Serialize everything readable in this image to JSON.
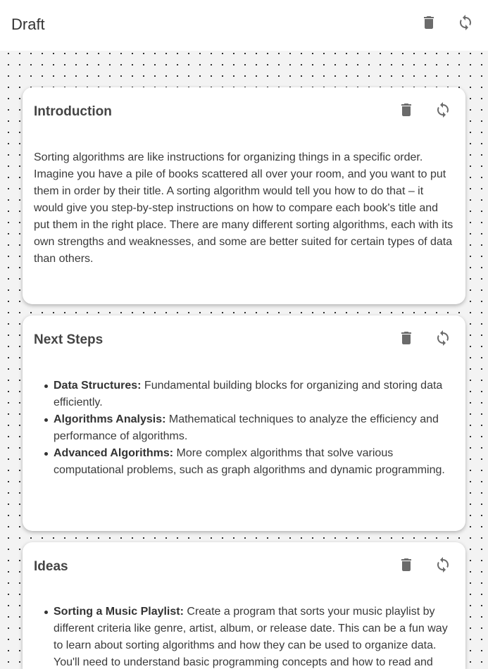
{
  "header": {
    "title": "Draft",
    "delete_icon": "trash-icon",
    "refresh_icon": "refresh-icon"
  },
  "cards": [
    {
      "title": "Introduction",
      "text": "Sorting algorithms are like instructions for organizing things in a specific order. Imagine you have a pile of books scattered all over your room, and you want to put them in order by their title. A sorting algorithm would tell you how to do that – it would give you step-by-step instructions on how to compare each book's title and put them in the right place. There are many different sorting algorithms, each with its own strengths and weaknesses, and some are better suited for certain types of data than others."
    },
    {
      "title": "Next Steps",
      "items": [
        {
          "term": "Data Structures:",
          "desc": " Fundamental building blocks for organizing and storing data efficiently."
        },
        {
          "term": "Algorithms Analysis:",
          "desc": " Mathematical techniques to analyze the efficiency and performance of algorithms."
        },
        {
          "term": "Advanced Algorithms:",
          "desc": " More complex algorithms that solve various computational problems, such as graph algorithms and dynamic programming."
        }
      ]
    },
    {
      "title": "Ideas",
      "items": [
        {
          "term": "Sorting a Music Playlist:",
          "desc": " Create a program that sorts your music playlist by different criteria like genre, artist, album, or release date. This can be a fun way to learn about sorting algorithms and how they can be used to organize data. You'll need to understand basic programming concepts and how to read and"
        }
      ]
    }
  ],
  "colors": {
    "background": "#f3f3f3",
    "card": "#ffffff",
    "icon": "#6b6b6b",
    "text": "#333333"
  }
}
